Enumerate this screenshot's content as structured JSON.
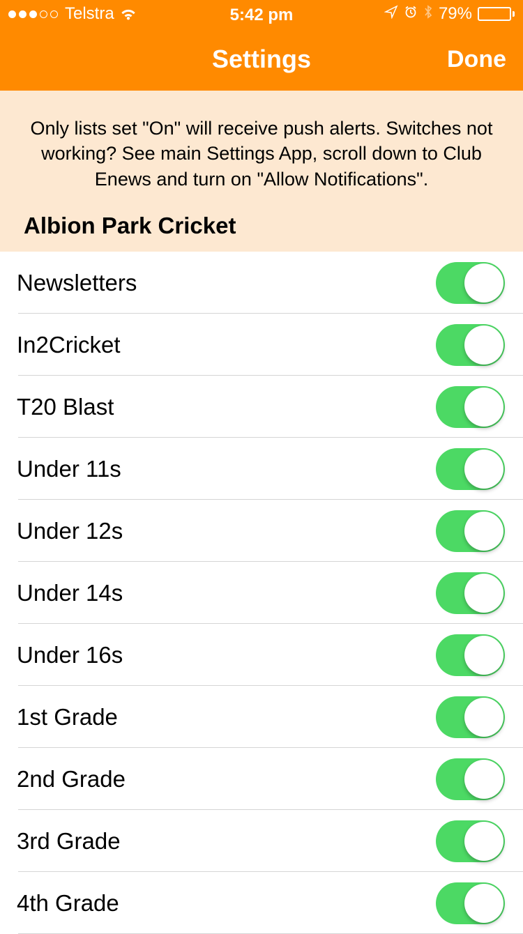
{
  "status_bar": {
    "carrier": "Telstra",
    "time": "5:42 pm",
    "battery_percent": "79%",
    "battery_fill": "79%"
  },
  "nav": {
    "title": "Settings",
    "done": "Done"
  },
  "info": "Only lists set \"On\" will receive push alerts. Switches not working? See main Settings App, scroll down to Club Enews and turn on \"Allow Notifications\".",
  "section": "Albion Park Cricket",
  "items": [
    {
      "label": "Newsletters",
      "on": true
    },
    {
      "label": "In2Cricket",
      "on": true
    },
    {
      "label": "T20 Blast",
      "on": true
    },
    {
      "label": "Under 11s",
      "on": true
    },
    {
      "label": "Under 12s",
      "on": true
    },
    {
      "label": "Under 14s",
      "on": true
    },
    {
      "label": "Under 16s",
      "on": true
    },
    {
      "label": "1st Grade",
      "on": true
    },
    {
      "label": "2nd Grade",
      "on": true
    },
    {
      "label": "3rd Grade",
      "on": true
    },
    {
      "label": "4th Grade",
      "on": true
    }
  ],
  "colors": {
    "accent": "#ff8a00",
    "toggle_on": "#4cd964",
    "info_bg": "#fde8d1"
  }
}
